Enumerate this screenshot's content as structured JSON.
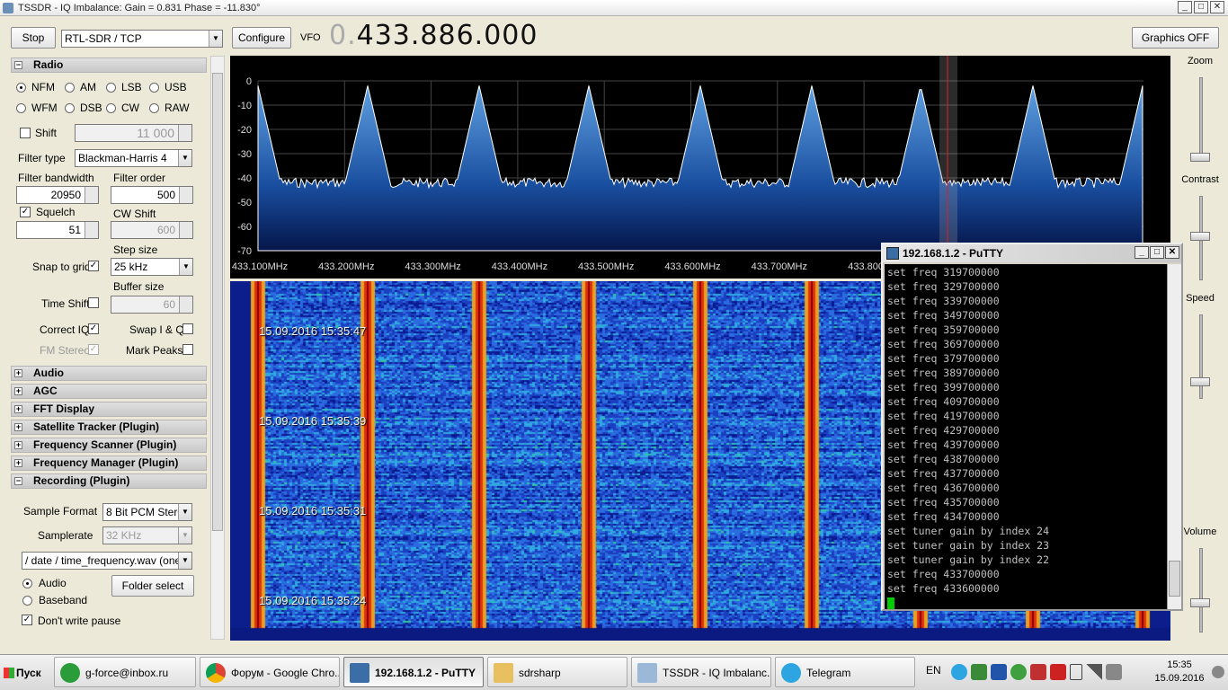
{
  "window": {
    "title": "TSSDR - IQ Imbalance: Gain = 0.831 Phase = -11.830°"
  },
  "toolbar": {
    "stop": "Stop",
    "source": "RTL-SDR / TCP",
    "configure": "Configure",
    "vfo_label": "VFO",
    "vfo_dim": "0.",
    "vfo_value": "433.886.000",
    "graphics": "Graphics OFF"
  },
  "radio": {
    "header": "Radio",
    "modes": [
      "NFM",
      "AM",
      "LSB",
      "USB",
      "WFM",
      "DSB",
      "CW",
      "RAW"
    ],
    "selected_mode": "NFM",
    "shift_label": "Shift",
    "shift_value": "11 000",
    "filter_type_label": "Filter type",
    "filter_type": "Blackman-Harris 4",
    "filter_bw_label": "Filter bandwidth",
    "filter_bw": "20950",
    "filter_order_label": "Filter order",
    "filter_order": "500",
    "squelch_label": "Squelch",
    "squelch_value": "51",
    "cw_shift_label": "CW Shift",
    "cw_shift": "600",
    "step_size_label": "Step size",
    "snap_label": "Snap to grid",
    "step_size": "25 kHz",
    "buffer_size_label": "Buffer size",
    "time_shift_label": "Time Shift",
    "buffer_size": "60",
    "correct_iq": "Correct IQ",
    "swap_iq": "Swap I & Q",
    "fm_stereo": "FM Stereo",
    "mark_peaks": "Mark Peaks"
  },
  "sections": [
    "Audio",
    "AGC",
    "FFT Display",
    "Satellite Tracker (Plugin)",
    "Frequency Scanner (Plugin)",
    "Frequency Manager (Plugin)",
    "Recording (Plugin)"
  ],
  "recording": {
    "sample_format_label": "Sample Format",
    "sample_format": "8 Bit PCM Stereo",
    "samplerate_label": "Samplerate",
    "samplerate": "32 KHz",
    "path_format": "/ date / time_frequency.wav (one fil",
    "audio": "Audio",
    "baseband": "Baseband",
    "folder_select": "Folder select",
    "dont_write_pause": "Don't write pause"
  },
  "fft": {
    "y_ticks": [
      "0",
      "-10",
      "-20",
      "-30",
      "-40",
      "-50",
      "-60",
      "-70"
    ],
    "x_ticks": [
      "433.100MHz",
      "433.200MHz",
      "433.300MHz",
      "433.400MHz",
      "433.500MHz",
      "433.600MHz",
      "433.700MHz",
      "433.800"
    ]
  },
  "waterfall": {
    "timestamps": [
      "15.09.2016 15:35:47",
      "15.09.2016 15:35:39",
      "15.09.2016 15:35:31",
      "15.09.2016 15:35:24"
    ]
  },
  "side": {
    "zoom": "Zoom",
    "contrast": "Contrast",
    "speed": "Speed",
    "volume": "Volume"
  },
  "putty": {
    "title": "192.168.1.2 - PuTTY",
    "lines": [
      "set freq 319700000",
      "set freq 329700000",
      "set freq 339700000",
      "set freq 349700000",
      "set freq 359700000",
      "set freq 369700000",
      "set freq 379700000",
      "set freq 389700000",
      "set freq 399700000",
      "set freq 409700000",
      "set freq 419700000",
      "set freq 429700000",
      "set freq 439700000",
      "set freq 438700000",
      "set freq 437700000",
      "set freq 436700000",
      "set freq 435700000",
      "set freq 434700000",
      "set tuner gain by index 24",
      "set tuner gain by index 23",
      "set tuner gain by index 22",
      "set freq 433700000",
      "set freq 433600000"
    ]
  },
  "taskbar": {
    "start": "Пуск",
    "tasks": [
      "g-force@inbox.ru",
      "Форум - Google Chro...",
      "192.168.1.2 - PuTTY",
      "sdrsharp",
      "TSSDR - IQ Imbalanc...",
      "Telegram"
    ],
    "lang": "EN",
    "time": "15:35",
    "date": "15.09.2016"
  }
}
